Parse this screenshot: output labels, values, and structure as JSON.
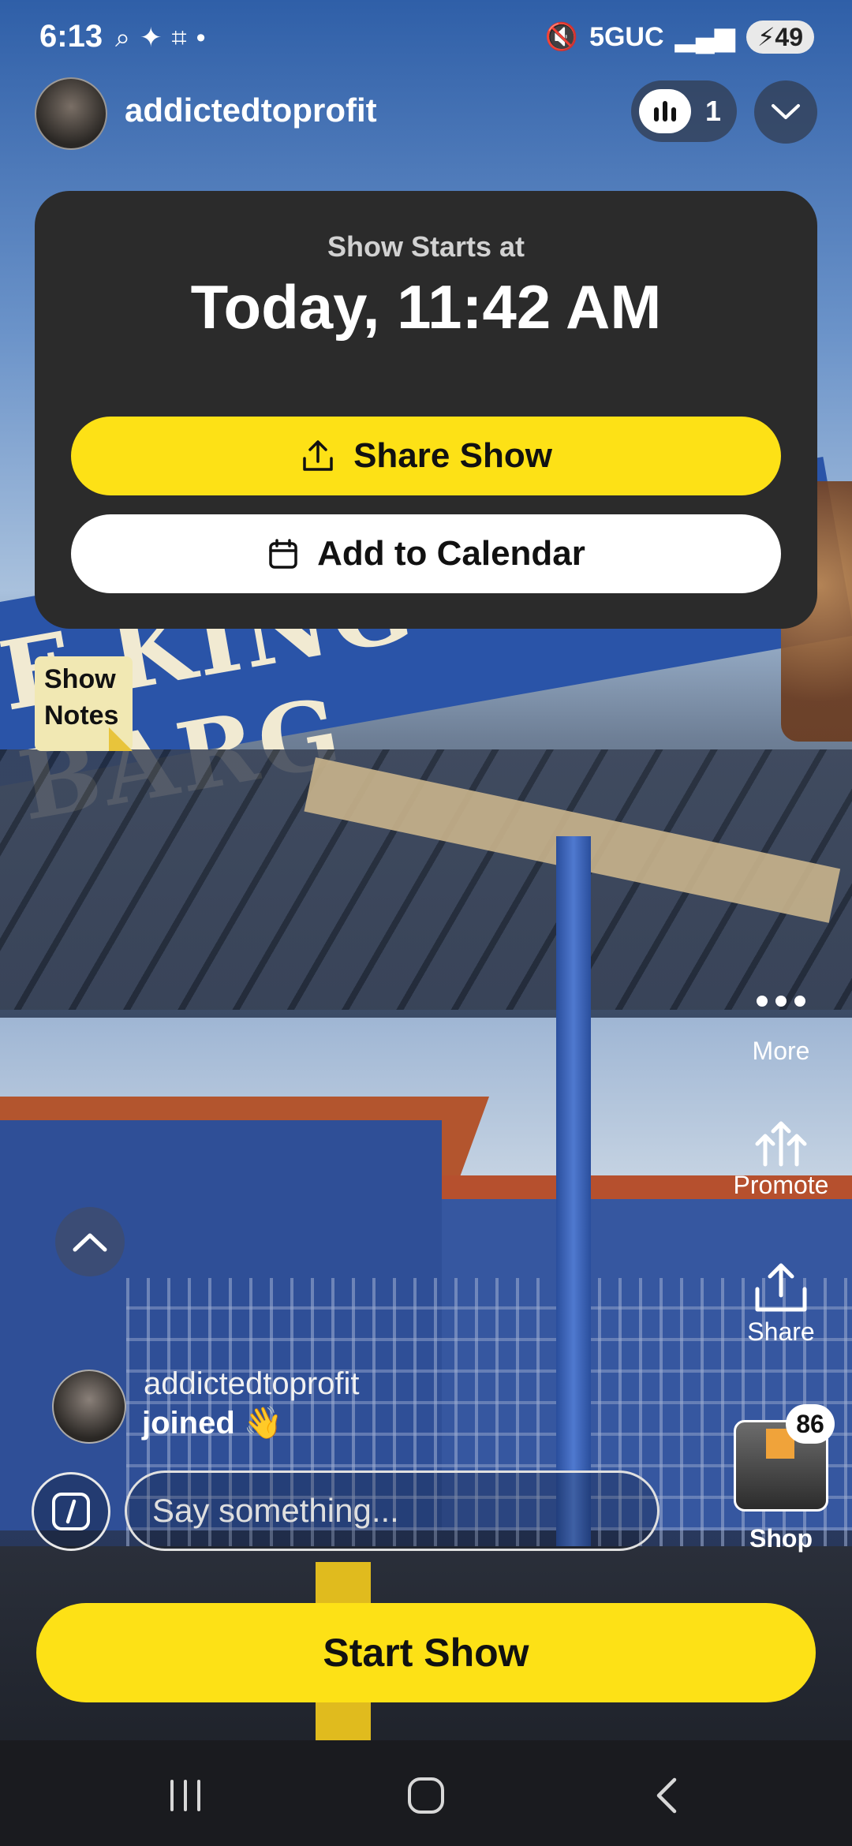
{
  "status_bar": {
    "time": "6:13",
    "network": "5GUC",
    "battery": "49"
  },
  "header": {
    "username": "addictedtoprofit",
    "viewer_count": "1"
  },
  "start_card": {
    "label": "Show Starts at",
    "time": "Today, 11:42 AM",
    "share_label": "Share Show",
    "calendar_label": "Add to Calendar"
  },
  "show_notes": {
    "line1": "Show",
    "line2": "Notes"
  },
  "background_sign_text": "E KING OF BARG",
  "actions": {
    "more": "More",
    "promote": "Promote",
    "share": "Share",
    "shop": "Shop",
    "shop_count": "86"
  },
  "chat": {
    "joined_user": "addictedtoprofit",
    "joined_text": "joined 👋",
    "placeholder": "Say something..."
  },
  "start_show_label": "Start Show",
  "colors": {
    "accent_yellow": "#fde116",
    "card_bg": "#2b2b2b"
  }
}
